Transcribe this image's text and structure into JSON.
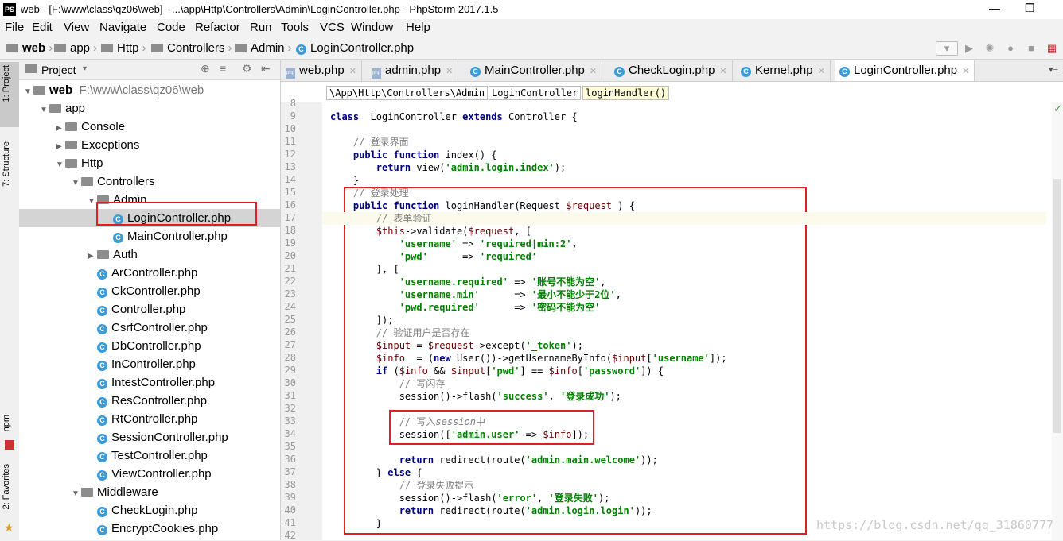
{
  "window": {
    "title": "web - [F:\\www\\class\\qz06\\web] - ...\\app\\Http\\Controllers\\Admin\\LoginController.php - PhpStorm 2017.1.5",
    "app_icon_text": "PS"
  },
  "menu": [
    "File",
    "Edit",
    "View",
    "Navigate",
    "Code",
    "Refactor",
    "Run",
    "Tools",
    "VCS",
    "Window",
    "Help"
  ],
  "nav": {
    "crumbs": [
      "web",
      "app",
      "Http",
      "Controllers",
      "Admin",
      "LoginController.php"
    ]
  },
  "left_tabs": {
    "project": "1: Project",
    "structure": "7: Structure",
    "npm": "npm",
    "favorites": "2: Favorites"
  },
  "project": {
    "header": "Project",
    "root_name": "web",
    "root_path": "F:\\www\\class\\qz06\\web",
    "items": [
      {
        "label": "app",
        "indent": 1,
        "kind": "folder",
        "open": true
      },
      {
        "label": "Console",
        "indent": 2,
        "kind": "folder",
        "open": false
      },
      {
        "label": "Exceptions",
        "indent": 2,
        "kind": "folder",
        "open": false
      },
      {
        "label": "Http",
        "indent": 2,
        "kind": "folder",
        "open": true
      },
      {
        "label": "Controllers",
        "indent": 3,
        "kind": "folder",
        "open": true
      },
      {
        "label": "Admin",
        "indent": 4,
        "kind": "folder",
        "open": true
      },
      {
        "label": "LoginController.php",
        "indent": 5,
        "kind": "class",
        "selected": true
      },
      {
        "label": "MainController.php",
        "indent": 5,
        "kind": "class"
      },
      {
        "label": "Auth",
        "indent": 4,
        "kind": "folder",
        "open": false
      },
      {
        "label": "ArController.php",
        "indent": 4,
        "kind": "class"
      },
      {
        "label": "CkController.php",
        "indent": 4,
        "kind": "class"
      },
      {
        "label": "Controller.php",
        "indent": 4,
        "kind": "class"
      },
      {
        "label": "CsrfController.php",
        "indent": 4,
        "kind": "class"
      },
      {
        "label": "DbController.php",
        "indent": 4,
        "kind": "class"
      },
      {
        "label": "InController.php",
        "indent": 4,
        "kind": "class"
      },
      {
        "label": "IntestController.php",
        "indent": 4,
        "kind": "class"
      },
      {
        "label": "ResController.php",
        "indent": 4,
        "kind": "class"
      },
      {
        "label": "RtController.php",
        "indent": 4,
        "kind": "class"
      },
      {
        "label": "SessionController.php",
        "indent": 4,
        "kind": "class"
      },
      {
        "label": "TestController.php",
        "indent": 4,
        "kind": "class"
      },
      {
        "label": "ViewController.php",
        "indent": 4,
        "kind": "class"
      },
      {
        "label": "Middleware",
        "indent": 3,
        "kind": "folder",
        "open": true
      },
      {
        "label": "CheckLogin.php",
        "indent": 4,
        "kind": "class"
      },
      {
        "label": "EncryptCookies.php",
        "indent": 4,
        "kind": "class"
      }
    ]
  },
  "tabs": [
    {
      "label": "web.php",
      "kind": "php"
    },
    {
      "label": "admin.php",
      "kind": "php"
    },
    {
      "label": "MainController.php",
      "kind": "class"
    },
    {
      "label": "CheckLogin.php",
      "kind": "class"
    },
    {
      "label": "Kernel.php",
      "kind": "class"
    },
    {
      "label": "LoginController.php",
      "kind": "class",
      "active": true
    }
  ],
  "editor_breadcrumb": [
    "\\App\\Http\\Controllers\\Admin",
    "LoginController",
    "loginHandler()"
  ],
  "line_numbers": [
    "8",
    "9",
    "10",
    "11",
    "12",
    "13",
    "14",
    "15",
    "16",
    "17",
    "18",
    "19",
    "20",
    "21",
    "22",
    "23",
    "24",
    "25",
    "26",
    "27",
    "28",
    "29",
    "30",
    "31",
    "32",
    "33",
    "34",
    "35",
    "36",
    "37",
    "38",
    "39",
    "40",
    "41",
    "42"
  ],
  "code_lines": [
    [],
    [
      [
        "kw",
        "class"
      ],
      [
        "",
        "  LoginController "
      ],
      [
        "kw",
        "extends"
      ],
      [
        "",
        " Controller {"
      ]
    ],
    [],
    [
      [
        "",
        "    "
      ],
      [
        "cm",
        "// 登录界面"
      ]
    ],
    [
      [
        "",
        "    "
      ],
      [
        "kw",
        "public function"
      ],
      [
        "",
        " index() {"
      ]
    ],
    [
      [
        "",
        "        "
      ],
      [
        "kw",
        "return"
      ],
      [
        "",
        " view("
      ],
      [
        "str",
        "'admin.login.index'"
      ],
      [
        "",
        ");"
      ]
    ],
    [
      [
        "",
        "    }"
      ]
    ],
    [
      [
        "",
        "    "
      ],
      [
        "cm",
        "// 登录处理"
      ]
    ],
    [
      [
        "",
        "    "
      ],
      [
        "kw",
        "public function"
      ],
      [
        "",
        " loginHandler(Request "
      ],
      [
        "var",
        "$request"
      ],
      [
        "",
        " ) {"
      ]
    ],
    [
      [
        "",
        "        "
      ],
      [
        "cm",
        "// 表单验证"
      ]
    ],
    [
      [
        "",
        "        "
      ],
      [
        "var",
        "$this"
      ],
      [
        "",
        "->validate("
      ],
      [
        "var",
        "$request"
      ],
      [
        "",
        ", ["
      ]
    ],
    [
      [
        "",
        "            "
      ],
      [
        "str",
        "'username'"
      ],
      [
        "",
        " => "
      ],
      [
        "str",
        "'required|min:2'"
      ],
      [
        "",
        ","
      ]
    ],
    [
      [
        "",
        "            "
      ],
      [
        "str",
        "'pwd'"
      ],
      [
        "",
        "      => "
      ],
      [
        "str",
        "'required'"
      ]
    ],
    [
      [
        "",
        "        ], ["
      ]
    ],
    [
      [
        "",
        "            "
      ],
      [
        "str",
        "'username.required'"
      ],
      [
        "",
        " => "
      ],
      [
        "str",
        "'账号不能为空'"
      ],
      [
        "",
        ","
      ]
    ],
    [
      [
        "",
        "            "
      ],
      [
        "str",
        "'username.min'"
      ],
      [
        "",
        "      => "
      ],
      [
        "str",
        "'最小不能少于2位'"
      ],
      [
        "",
        ","
      ]
    ],
    [
      [
        "",
        "            "
      ],
      [
        "str",
        "'pwd.required'"
      ],
      [
        "",
        "      => "
      ],
      [
        "str",
        "'密码不能为空'"
      ]
    ],
    [
      [
        "",
        "        ]);"
      ]
    ],
    [
      [
        "",
        "        "
      ],
      [
        "cm",
        "// 验证用户是否存在"
      ]
    ],
    [
      [
        "",
        "        "
      ],
      [
        "var",
        "$input"
      ],
      [
        "",
        " = "
      ],
      [
        "var",
        "$request"
      ],
      [
        "",
        "->except("
      ],
      [
        "str",
        "'_token'"
      ],
      [
        "",
        ");"
      ]
    ],
    [
      [
        "",
        "        "
      ],
      [
        "var",
        "$info"
      ],
      [
        "",
        "  = ("
      ],
      [
        "kw",
        "new"
      ],
      [
        "",
        " User())->getUsernameByInfo("
      ],
      [
        "var",
        "$input"
      ],
      [
        "",
        "["
      ],
      [
        "str",
        "'username'"
      ],
      [
        "",
        "]);"
      ]
    ],
    [
      [
        "",
        "        "
      ],
      [
        "kw",
        "if"
      ],
      [
        "",
        " ("
      ],
      [
        "var",
        "$info"
      ],
      [
        "",
        " && "
      ],
      [
        "var",
        "$input"
      ],
      [
        "",
        "["
      ],
      [
        "str",
        "'pwd'"
      ],
      [
        "",
        "] == "
      ],
      [
        "var",
        "$info"
      ],
      [
        "",
        "["
      ],
      [
        "str",
        "'password'"
      ],
      [
        "",
        "]) {"
      ]
    ],
    [
      [
        "",
        "            "
      ],
      [
        "cm",
        "// 写闪存"
      ]
    ],
    [
      [
        "",
        "            session()->flash("
      ],
      [
        "str",
        "'success'"
      ],
      [
        "",
        ", "
      ],
      [
        "str",
        "'登录成功'"
      ],
      [
        "",
        ");"
      ]
    ],
    [],
    [
      [
        "",
        "            "
      ],
      [
        "cm",
        "// 写入"
      ],
      [
        "cmi",
        "session"
      ],
      [
        "cm",
        "中"
      ]
    ],
    [
      [
        "",
        "            session(["
      ],
      [
        "str",
        "'admin.user'"
      ],
      [
        "",
        " => "
      ],
      [
        "var",
        "$info"
      ],
      [
        "",
        "]);"
      ]
    ],
    [],
    [
      [
        "",
        "            "
      ],
      [
        "kw",
        "return"
      ],
      [
        "",
        " redirect(route("
      ],
      [
        "str",
        "'admin.main.welcome'"
      ],
      [
        "",
        "));"
      ]
    ],
    [
      [
        "",
        "        } "
      ],
      [
        "kw",
        "else"
      ],
      [
        "",
        " {"
      ]
    ],
    [
      [
        "",
        "            "
      ],
      [
        "cm",
        "// 登录失败提示"
      ]
    ],
    [
      [
        "",
        "            session()->flash("
      ],
      [
        "str",
        "'error'"
      ],
      [
        "",
        ", "
      ],
      [
        "str",
        "'登录失败'"
      ],
      [
        "",
        ");"
      ]
    ],
    [
      [
        "",
        "            "
      ],
      [
        "kw",
        "return"
      ],
      [
        "",
        " redirect(route("
      ],
      [
        "str",
        "'admin.login.login'"
      ],
      [
        "",
        "));"
      ]
    ],
    [
      [
        "",
        "        }"
      ]
    ],
    []
  ],
  "watermark": "https://blog.csdn.net/qq_31860777"
}
